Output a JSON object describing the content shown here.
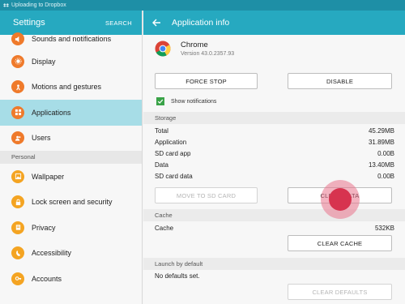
{
  "status_bar": {
    "text": "Uploading to Dropbox",
    "icon": "dropbox-icon"
  },
  "settings": {
    "title": "Settings",
    "search_label": "SEARCH",
    "items_top": [
      {
        "label": "Sounds and notifications",
        "icon": "sound-icon",
        "color": "#ef7a2b"
      },
      {
        "label": "Display",
        "icon": "display-icon",
        "color": "#ef7a2b"
      },
      {
        "label": "Motions and gestures",
        "icon": "motion-icon",
        "color": "#ef7a2b"
      },
      {
        "label": "Applications",
        "icon": "apps-grid-icon",
        "color": "#ef7a2b",
        "active": true
      },
      {
        "label": "Users",
        "icon": "users-icon",
        "color": "#ef7a2b"
      }
    ],
    "section_personal": "Personal",
    "items_personal": [
      {
        "label": "Wallpaper",
        "icon": "wallpaper-icon",
        "color": "#f4a422"
      },
      {
        "label": "Lock screen and security",
        "icon": "lock-icon",
        "color": "#f4a422"
      },
      {
        "label": "Privacy",
        "icon": "privacy-icon",
        "color": "#f4a422"
      },
      {
        "label": "Accessibility",
        "icon": "accessibility-icon",
        "color": "#f4a422"
      },
      {
        "label": "Accounts",
        "icon": "key-icon",
        "color": "#f4a422"
      }
    ]
  },
  "app_info": {
    "title": "Application info",
    "app_name": "Chrome",
    "version": "Version 43.0.2357.93",
    "force_stop": "FORCE STOP",
    "disable": "DISABLE",
    "show_notifications": "Show notifications",
    "storage_header": "Storage",
    "storage": [
      {
        "label": "Total",
        "value": "45.29MB"
      },
      {
        "label": "Application",
        "value": "31.89MB"
      },
      {
        "label": "SD card app",
        "value": "0.00B"
      },
      {
        "label": "Data",
        "value": "13.40MB"
      },
      {
        "label": "SD card data",
        "value": "0.00B"
      }
    ],
    "move_to_sd": "MOVE TO SD CARD",
    "clear_data": "CLEAR DATA",
    "cache_header": "Cache",
    "cache_label": "Cache",
    "cache_value": "532KB",
    "clear_cache": "CLEAR CACHE",
    "launch_header": "Launch by default",
    "no_defaults": "No defaults set.",
    "clear_defaults": "CLEAR DEFAULTS"
  },
  "colors": {
    "accent": "#26a9c0",
    "active_row": "#a7dde7",
    "touch": "#d7334f"
  }
}
